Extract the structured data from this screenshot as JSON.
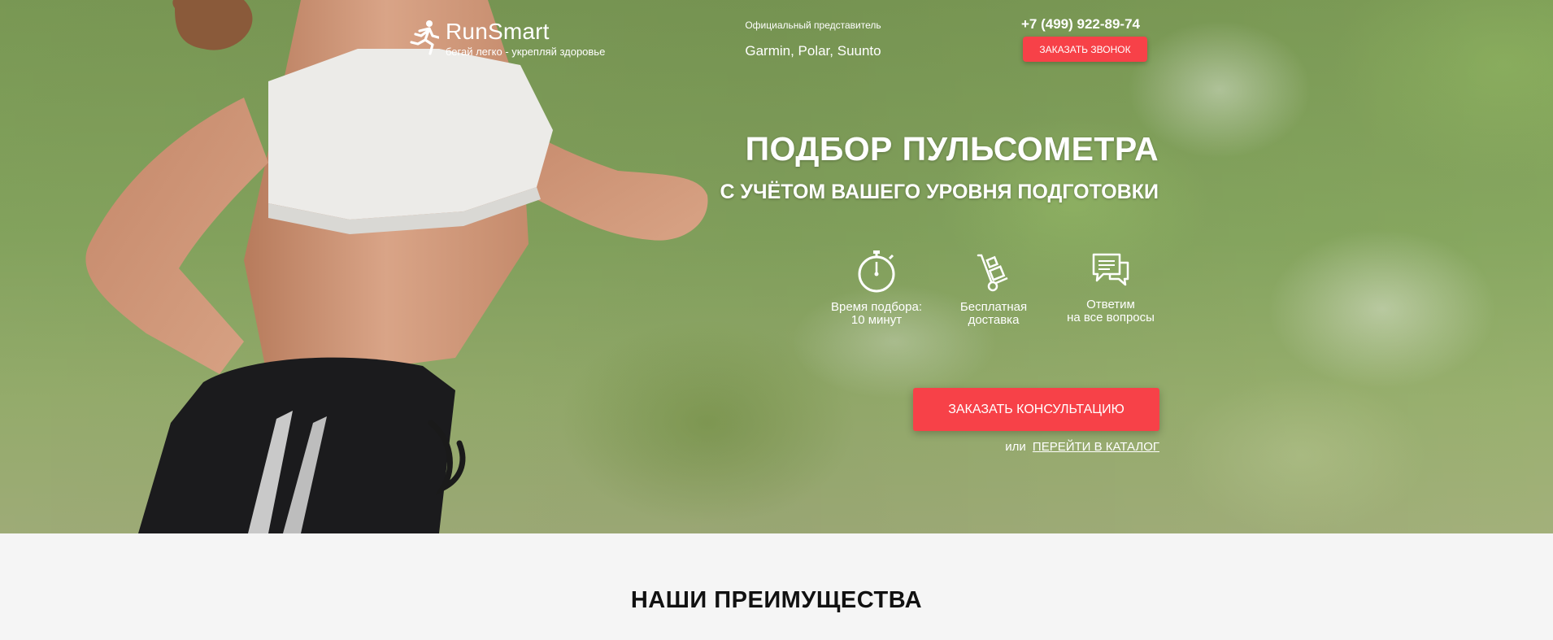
{
  "header": {
    "logo": {
      "name": "RunSmart",
      "tagline": "бегай легко - укрепляй здоровье"
    },
    "official": {
      "label": "Официальный представитель",
      "brands": "Garmin, Polar, Suunto"
    },
    "phone": "+7 (499) 922-89-74",
    "call_button": "ЗАКАЗАТЬ ЗВОНОК"
  },
  "hero": {
    "title": "ПОДБОР ПУЛЬСОМЕТРА",
    "subtitle": "С УЧЁТОМ ВАШЕГО УРОВНЯ ПОДГОТОВКИ",
    "features": [
      {
        "icon": "stopwatch-icon",
        "line1": "Время подбора:",
        "line2": "10 минут"
      },
      {
        "icon": "hand-truck-icon",
        "line1": "Бесплатная",
        "line2": "доставка"
      },
      {
        "icon": "chat-bubbles-icon",
        "line1": "Ответим",
        "line2": "на все вопросы"
      }
    ],
    "consult_button": "ЗАКАЗАТЬ КОНСУЛЬТАЦИЮ",
    "catalog_prefix": "или",
    "catalog_link": "ПЕРЕЙТИ В КАТАЛОГ"
  },
  "advantages": {
    "title": "НАШИ ПРЕИМУЩЕСТВА"
  },
  "colors": {
    "accent": "#f74148",
    "hero_green": "#8aab62",
    "section_bg": "#f5f5f5"
  }
}
